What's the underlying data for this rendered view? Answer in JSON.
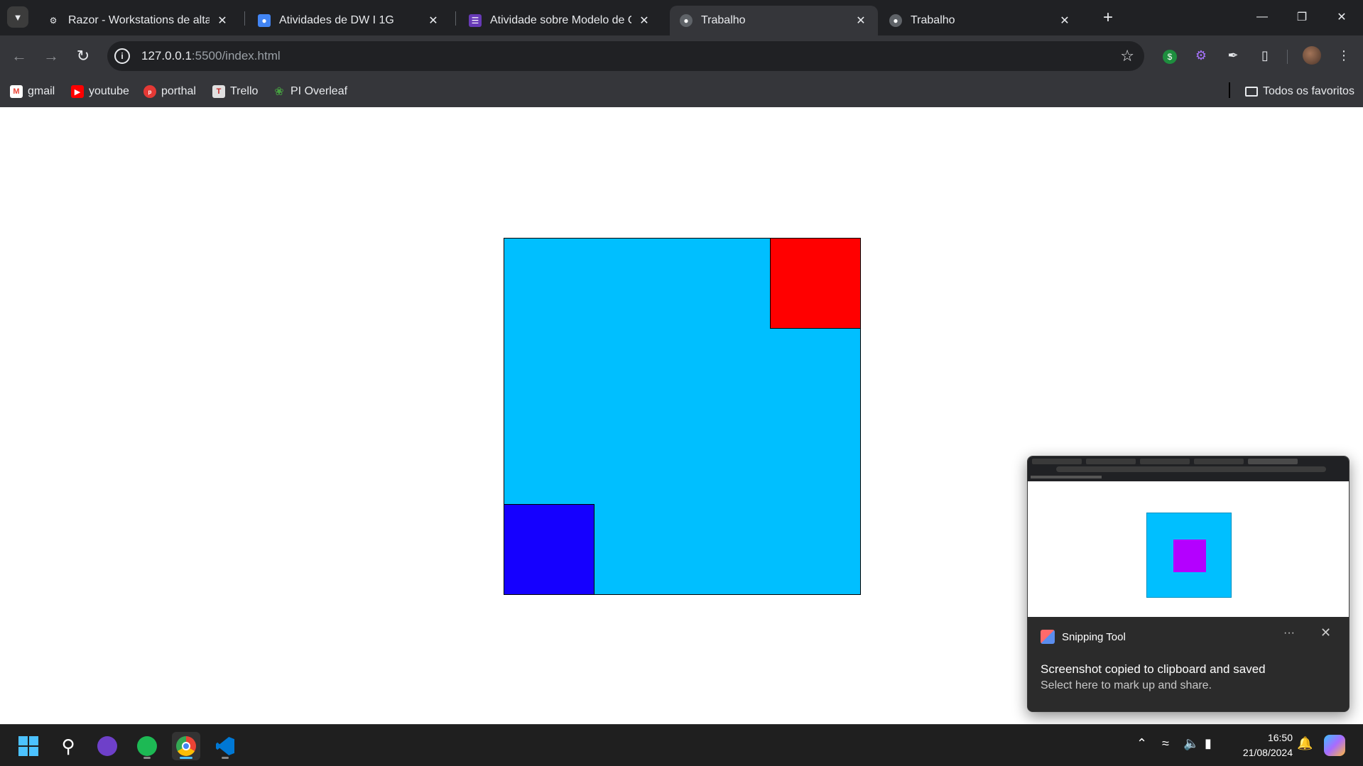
{
  "browser": {
    "tabs": [
      {
        "title": "Razor - Workstations de alta pe",
        "favicon": "razor-icon",
        "active": false
      },
      {
        "title": "Atividades de DW I 1G",
        "favicon": "classroom-icon",
        "active": false
      },
      {
        "title": "Atividade sobre Modelo de Cai",
        "favicon": "forms-icon",
        "active": false
      },
      {
        "title": "Trabalho",
        "favicon": "globe-icon",
        "active": true
      },
      {
        "title": "Trabalho",
        "favicon": "globe-icon",
        "active": false
      }
    ],
    "address": {
      "host": "127.0.0.1",
      "path": ":5500/index.html"
    },
    "bookmarks": [
      {
        "label": "gmail",
        "icon": "gmail-icon"
      },
      {
        "label": "youtube",
        "icon": "youtube-icon"
      },
      {
        "label": "porthal",
        "icon": "porthal-icon"
      },
      {
        "label": "Trello",
        "icon": "trello-icon"
      },
      {
        "label": "PI Overleaf",
        "icon": "overleaf-icon"
      }
    ],
    "all_bookmarks_label": "Todos os favoritos"
  },
  "page": {
    "colors": {
      "square": "#00bfff",
      "top_right": "#ff0000",
      "bottom_left": "#1500ff"
    }
  },
  "toast": {
    "app_name": "Snipping Tool",
    "message": "Screenshot copied to clipboard and saved",
    "submessage": "Select here to mark up and share.",
    "preview_colors": {
      "square": "#00bfff",
      "inner": "#b400ff"
    }
  },
  "taskbar": {
    "time": "16:50",
    "date": "21/08/2024"
  }
}
